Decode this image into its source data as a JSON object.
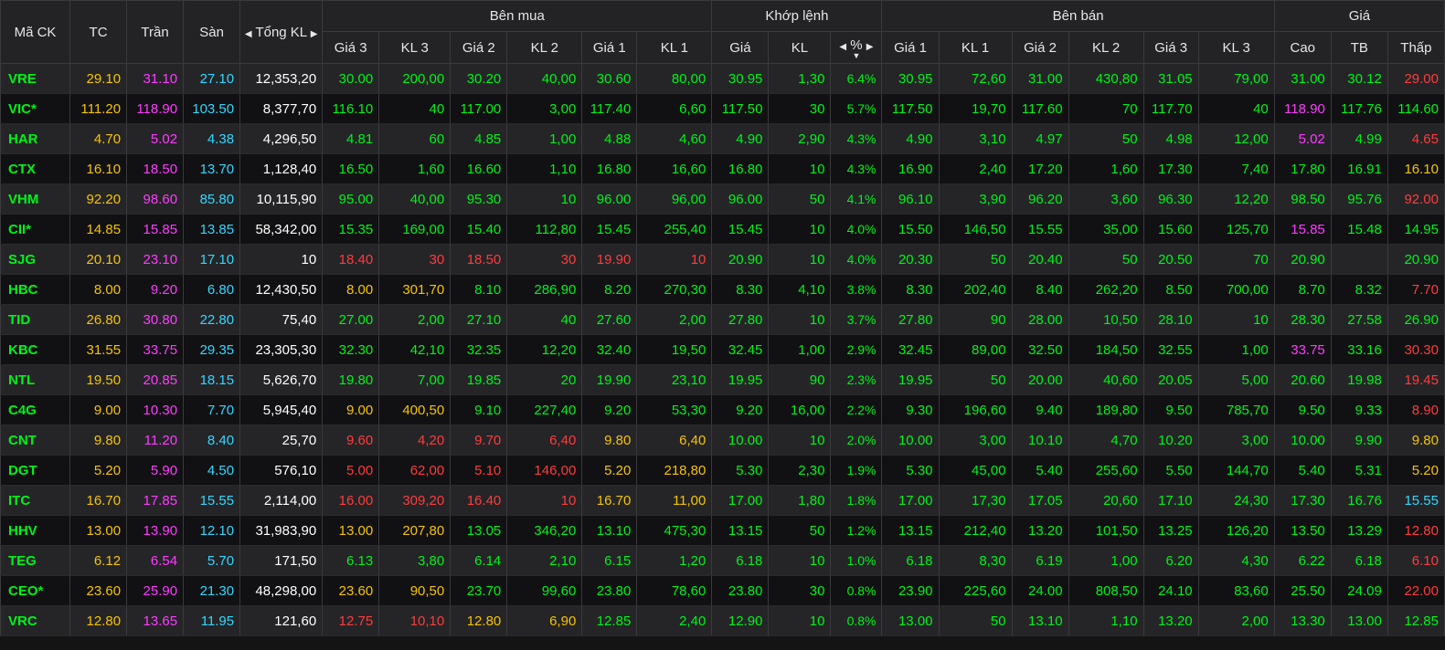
{
  "colors": {
    "up": "#00f21a",
    "down": "#ff3b3b",
    "ref": "#f5c400",
    "ceil": "#ff3bff",
    "floor": "#32d7ff"
  },
  "headers": {
    "symbol": "Mã CK",
    "ref": "TC",
    "ceil": "Trần",
    "floor": "Sàn",
    "total": "Tổng KL",
    "buy_group": "Bên mua",
    "match_group": "Khớp lệnh",
    "sell_group": "Bên bán",
    "price_group": "Giá",
    "g3": "Giá 3",
    "kl3": "KL 3",
    "g2": "Giá 2",
    "kl2": "KL 2",
    "g1": "Giá 1",
    "kl1": "KL 1",
    "match_price": "Giá",
    "match_vol": "KL",
    "match_pct": "%",
    "high": "Cao",
    "avg": "TB",
    "low": "Thấp"
  },
  "rows": [
    {
      "cells": [
        "VRE",
        "29.10",
        "31.10",
        "27.10",
        "12,353,20",
        "30.00",
        "200,00",
        "30.20",
        "40,00",
        "30.60",
        "80,00",
        "30.95",
        "1,30",
        "6.4%",
        "30.95",
        "72,60",
        "31.00",
        "430,80",
        "31.05",
        "79,00",
        "31.00",
        "30.12",
        "29.00"
      ],
      "cls": [
        "up",
        "ref",
        "ceil",
        "floor",
        "tot",
        "up",
        "up",
        "up",
        "up",
        "up",
        "up",
        "up",
        "up",
        "up",
        "up",
        "up",
        "up",
        "up",
        "up",
        "up",
        "up",
        "up",
        "down"
      ]
    },
    {
      "cells": [
        "VIC*",
        "111.20",
        "118.90",
        "103.50",
        "8,377,70",
        "116.10",
        "40",
        "117.00",
        "3,00",
        "117.40",
        "6,60",
        "117.50",
        "30",
        "5.7%",
        "117.50",
        "19,70",
        "117.60",
        "70",
        "117.70",
        "40",
        "118.90",
        "117.76",
        "114.60"
      ],
      "cls": [
        "up",
        "ref",
        "ceil",
        "floor",
        "tot",
        "up",
        "up",
        "up",
        "up",
        "up",
        "up",
        "up",
        "up",
        "up",
        "up",
        "up",
        "up",
        "up",
        "up",
        "up",
        "ceil",
        "up",
        "up"
      ]
    },
    {
      "cells": [
        "HAR",
        "4.70",
        "5.02",
        "4.38",
        "4,296,50",
        "4.81",
        "60",
        "4.85",
        "1,00",
        "4.88",
        "4,60",
        "4.90",
        "2,90",
        "4.3%",
        "4.90",
        "3,10",
        "4.97",
        "50",
        "4.98",
        "12,00",
        "5.02",
        "4.99",
        "4.65"
      ],
      "cls": [
        "up",
        "ref",
        "ceil",
        "floor",
        "tot",
        "up",
        "up",
        "up",
        "up",
        "up",
        "up",
        "up",
        "up",
        "up",
        "up",
        "up",
        "up",
        "up",
        "up",
        "up",
        "ceil",
        "up",
        "down"
      ]
    },
    {
      "cells": [
        "CTX",
        "16.10",
        "18.50",
        "13.70",
        "1,128,40",
        "16.50",
        "1,60",
        "16.60",
        "1,10",
        "16.80",
        "16,60",
        "16.80",
        "10",
        "4.3%",
        "16.90",
        "2,40",
        "17.20",
        "1,60",
        "17.30",
        "7,40",
        "17.80",
        "16.91",
        "16.10"
      ],
      "cls": [
        "up",
        "ref",
        "ceil",
        "floor",
        "tot",
        "up",
        "up",
        "up",
        "up",
        "up",
        "up",
        "up",
        "up",
        "up",
        "up",
        "up",
        "up",
        "up",
        "up",
        "up",
        "up",
        "up",
        "ref"
      ]
    },
    {
      "cells": [
        "VHM",
        "92.20",
        "98.60",
        "85.80",
        "10,115,90",
        "95.00",
        "40,00",
        "95.30",
        "10",
        "96.00",
        "96,00",
        "96.00",
        "50",
        "4.1%",
        "96.10",
        "3,90",
        "96.20",
        "3,60",
        "96.30",
        "12,20",
        "98.50",
        "95.76",
        "92.00"
      ],
      "cls": [
        "up",
        "ref",
        "ceil",
        "floor",
        "tot",
        "up",
        "up",
        "up",
        "up",
        "up",
        "up",
        "up",
        "up",
        "up",
        "up",
        "up",
        "up",
        "up",
        "up",
        "up",
        "up",
        "up",
        "down"
      ]
    },
    {
      "cells": [
        "CII*",
        "14.85",
        "15.85",
        "13.85",
        "58,342,00",
        "15.35",
        "169,00",
        "15.40",
        "112,80",
        "15.45",
        "255,40",
        "15.45",
        "10",
        "4.0%",
        "15.50",
        "146,50",
        "15.55",
        "35,00",
        "15.60",
        "125,70",
        "15.85",
        "15.48",
        "14.95"
      ],
      "cls": [
        "up",
        "ref",
        "ceil",
        "floor",
        "tot",
        "up",
        "up",
        "up",
        "up",
        "up",
        "up",
        "up",
        "up",
        "up",
        "up",
        "up",
        "up",
        "up",
        "up",
        "up",
        "ceil",
        "up",
        "up"
      ]
    },
    {
      "cells": [
        "SJG",
        "20.10",
        "23.10",
        "17.10",
        "10",
        "18.40",
        "30",
        "18.50",
        "30",
        "19.90",
        "10",
        "20.90",
        "10",
        "4.0%",
        "20.30",
        "50",
        "20.40",
        "50",
        "20.50",
        "70",
        "20.90",
        "",
        "20.90"
      ],
      "cls": [
        "up",
        "ref",
        "ceil",
        "floor",
        "tot",
        "down",
        "down",
        "down",
        "down",
        "down",
        "down",
        "up",
        "up",
        "up",
        "up",
        "up",
        "up",
        "up",
        "up",
        "up",
        "up",
        "up",
        "up"
      ]
    },
    {
      "cells": [
        "HBC",
        "8.00",
        "9.20",
        "6.80",
        "12,430,50",
        "8.00",
        "301,70",
        "8.10",
        "286,90",
        "8.20",
        "270,30",
        "8.30",
        "4,10",
        "3.8%",
        "8.30",
        "202,40",
        "8.40",
        "262,20",
        "8.50",
        "700,00",
        "8.70",
        "8.32",
        "7.70"
      ],
      "cls": [
        "up",
        "ref",
        "ceil",
        "floor",
        "tot",
        "ref",
        "ref",
        "up",
        "up",
        "up",
        "up",
        "up",
        "up",
        "up",
        "up",
        "up",
        "up",
        "up",
        "up",
        "up",
        "up",
        "up",
        "down"
      ]
    },
    {
      "cells": [
        "TID",
        "26.80",
        "30.80",
        "22.80",
        "75,40",
        "27.00",
        "2,00",
        "27.10",
        "40",
        "27.60",
        "2,00",
        "27.80",
        "10",
        "3.7%",
        "27.80",
        "90",
        "28.00",
        "10,50",
        "28.10",
        "10",
        "28.30",
        "27.58",
        "26.90"
      ],
      "cls": [
        "up",
        "ref",
        "ceil",
        "floor",
        "tot",
        "up",
        "up",
        "up",
        "up",
        "up",
        "up",
        "up",
        "up",
        "up",
        "up",
        "up",
        "up",
        "up",
        "up",
        "up",
        "up",
        "up",
        "up"
      ]
    },
    {
      "cells": [
        "KBC",
        "31.55",
        "33.75",
        "29.35",
        "23,305,30",
        "32.30",
        "42,10",
        "32.35",
        "12,20",
        "32.40",
        "19,50",
        "32.45",
        "1,00",
        "2.9%",
        "32.45",
        "89,00",
        "32.50",
        "184,50",
        "32.55",
        "1,00",
        "33.75",
        "33.16",
        "30.30"
      ],
      "cls": [
        "up",
        "ref",
        "ceil",
        "floor",
        "tot",
        "up",
        "up",
        "up",
        "up",
        "up",
        "up",
        "up",
        "up",
        "up",
        "up",
        "up",
        "up",
        "up",
        "up",
        "up",
        "ceil",
        "up",
        "down"
      ]
    },
    {
      "cells": [
        "NTL",
        "19.50",
        "20.85",
        "18.15",
        "5,626,70",
        "19.80",
        "7,00",
        "19.85",
        "20",
        "19.90",
        "23,10",
        "19.95",
        "90",
        "2.3%",
        "19.95",
        "50",
        "20.00",
        "40,60",
        "20.05",
        "5,00",
        "20.60",
        "19.98",
        "19.45"
      ],
      "cls": [
        "up",
        "ref",
        "ceil",
        "floor",
        "tot",
        "up",
        "up",
        "up",
        "up",
        "up",
        "up",
        "up",
        "up",
        "up",
        "up",
        "up",
        "up",
        "up",
        "up",
        "up",
        "up",
        "up",
        "down"
      ]
    },
    {
      "cells": [
        "C4G",
        "9.00",
        "10.30",
        "7.70",
        "5,945,40",
        "9.00",
        "400,50",
        "9.10",
        "227,40",
        "9.20",
        "53,30",
        "9.20",
        "16,00",
        "2.2%",
        "9.30",
        "196,60",
        "9.40",
        "189,80",
        "9.50",
        "785,70",
        "9.50",
        "9.33",
        "8.90"
      ],
      "cls": [
        "up",
        "ref",
        "ceil",
        "floor",
        "tot",
        "ref",
        "ref",
        "up",
        "up",
        "up",
        "up",
        "up",
        "up",
        "up",
        "up",
        "up",
        "up",
        "up",
        "up",
        "up",
        "up",
        "up",
        "down"
      ]
    },
    {
      "cells": [
        "CNT",
        "9.80",
        "11.20",
        "8.40",
        "25,70",
        "9.60",
        "4,20",
        "9.70",
        "6,40",
        "9.80",
        "6,40",
        "10.00",
        "10",
        "2.0%",
        "10.00",
        "3,00",
        "10.10",
        "4,70",
        "10.20",
        "3,00",
        "10.00",
        "9.90",
        "9.80"
      ],
      "cls": [
        "up",
        "ref",
        "ceil",
        "floor",
        "tot",
        "down",
        "down",
        "down",
        "down",
        "ref",
        "ref",
        "up",
        "up",
        "up",
        "up",
        "up",
        "up",
        "up",
        "up",
        "up",
        "up",
        "up",
        "ref"
      ]
    },
    {
      "cells": [
        "DGT",
        "5.20",
        "5.90",
        "4.50",
        "576,10",
        "5.00",
        "62,00",
        "5.10",
        "146,00",
        "5.20",
        "218,80",
        "5.30",
        "2,30",
        "1.9%",
        "5.30",
        "45,00",
        "5.40",
        "255,60",
        "5.50",
        "144,70",
        "5.40",
        "5.31",
        "5.20"
      ],
      "cls": [
        "up",
        "ref",
        "ceil",
        "floor",
        "tot",
        "down",
        "down",
        "down",
        "down",
        "ref",
        "ref",
        "up",
        "up",
        "up",
        "up",
        "up",
        "up",
        "up",
        "up",
        "up",
        "up",
        "up",
        "ref"
      ]
    },
    {
      "cells": [
        "ITC",
        "16.70",
        "17.85",
        "15.55",
        "2,114,00",
        "16.00",
        "309,20",
        "16.40",
        "10",
        "16.70",
        "11,00",
        "17.00",
        "1,80",
        "1.8%",
        "17.00",
        "17,30",
        "17.05",
        "20,60",
        "17.10",
        "24,30",
        "17.30",
        "16.76",
        "15.55"
      ],
      "cls": [
        "up",
        "ref",
        "ceil",
        "floor",
        "tot",
        "down",
        "down",
        "down",
        "down",
        "ref",
        "ref",
        "up",
        "up",
        "up",
        "up",
        "up",
        "up",
        "up",
        "up",
        "up",
        "up",
        "up",
        "floor"
      ]
    },
    {
      "cells": [
        "HHV",
        "13.00",
        "13.90",
        "12.10",
        "31,983,90",
        "13.00",
        "207,80",
        "13.05",
        "346,20",
        "13.10",
        "475,30",
        "13.15",
        "50",
        "1.2%",
        "13.15",
        "212,40",
        "13.20",
        "101,50",
        "13.25",
        "126,20",
        "13.50",
        "13.29",
        "12.80"
      ],
      "cls": [
        "up",
        "ref",
        "ceil",
        "floor",
        "tot",
        "ref",
        "ref",
        "up",
        "up",
        "up",
        "up",
        "up",
        "up",
        "up",
        "up",
        "up",
        "up",
        "up",
        "up",
        "up",
        "up",
        "up",
        "down"
      ]
    },
    {
      "cells": [
        "TEG",
        "6.12",
        "6.54",
        "5.70",
        "171,50",
        "6.13",
        "3,80",
        "6.14",
        "2,10",
        "6.15",
        "1,20",
        "6.18",
        "10",
        "1.0%",
        "6.18",
        "8,30",
        "6.19",
        "1,00",
        "6.20",
        "4,30",
        "6.22",
        "6.18",
        "6.10"
      ],
      "cls": [
        "up",
        "ref",
        "ceil",
        "floor",
        "tot",
        "up",
        "up",
        "up",
        "up",
        "up",
        "up",
        "up",
        "up",
        "up",
        "up",
        "up",
        "up",
        "up",
        "up",
        "up",
        "up",
        "up",
        "down"
      ]
    },
    {
      "cells": [
        "CEO*",
        "23.60",
        "25.90",
        "21.30",
        "48,298,00",
        "23.60",
        "90,50",
        "23.70",
        "99,60",
        "23.80",
        "78,60",
        "23.80",
        "30",
        "0.8%",
        "23.90",
        "225,60",
        "24.00",
        "808,50",
        "24.10",
        "83,60",
        "25.50",
        "24.09",
        "22.00"
      ],
      "cls": [
        "up",
        "ref",
        "ceil",
        "floor",
        "tot",
        "ref",
        "ref",
        "up",
        "up",
        "up",
        "up",
        "up",
        "up",
        "up",
        "up",
        "up",
        "up",
        "up",
        "up",
        "up",
        "up",
        "up",
        "down"
      ]
    },
    {
      "cells": [
        "VRC",
        "12.80",
        "13.65",
        "11.95",
        "121,60",
        "12.75",
        "10,10",
        "12.80",
        "6,90",
        "12.85",
        "2,40",
        "12.90",
        "10",
        "0.8%",
        "13.00",
        "50",
        "13.10",
        "1,10",
        "13.20",
        "2,00",
        "13.30",
        "13.00",
        "12.85"
      ],
      "cls": [
        "up",
        "ref",
        "ceil",
        "floor",
        "tot",
        "down",
        "down",
        "ref",
        "ref",
        "up",
        "up",
        "up",
        "up",
        "up",
        "up",
        "up",
        "up",
        "up",
        "up",
        "up",
        "up",
        "up",
        "up"
      ]
    }
  ]
}
